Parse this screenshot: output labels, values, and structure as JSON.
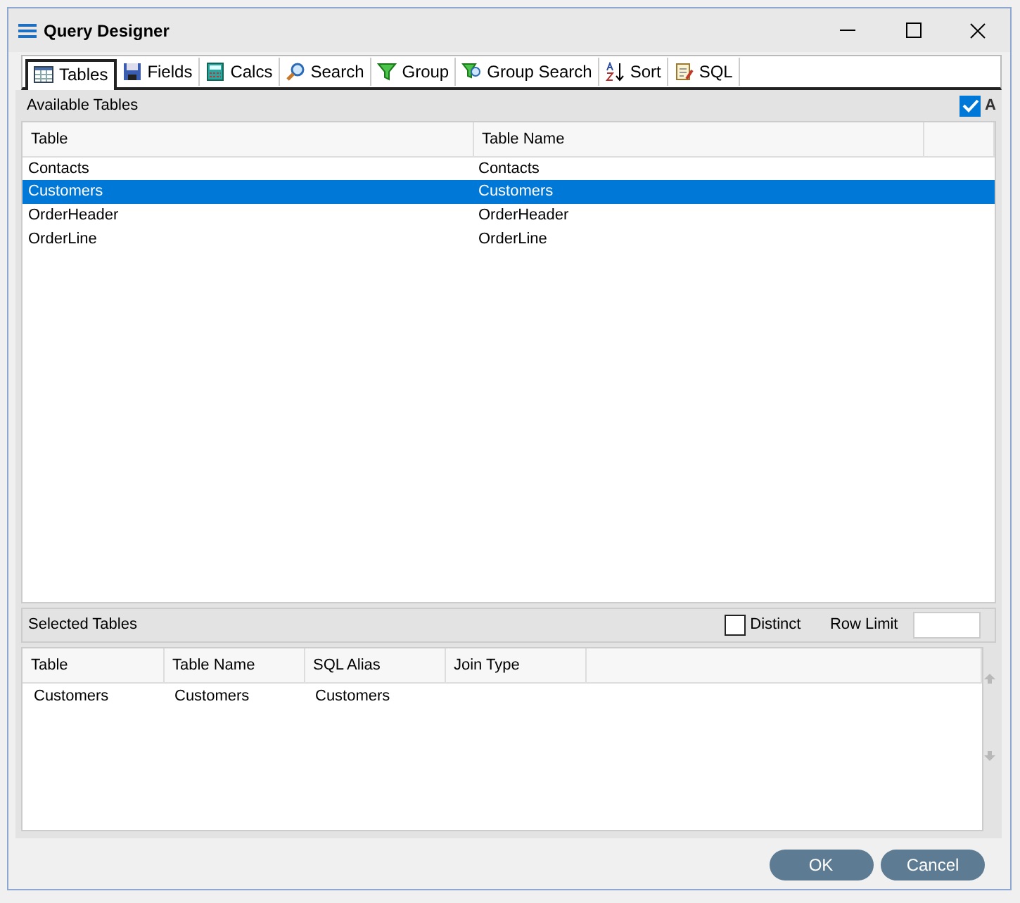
{
  "window": {
    "title": "Query Designer"
  },
  "tabs": [
    {
      "label": "Tables",
      "selected": true
    },
    {
      "label": "Fields",
      "selected": false
    },
    {
      "label": "Calcs",
      "selected": false
    },
    {
      "label": "Search",
      "selected": false
    },
    {
      "label": "Group",
      "selected": false
    },
    {
      "label": "Group Search",
      "selected": false
    },
    {
      "label": "Sort",
      "selected": false
    },
    {
      "label": "SQL",
      "selected": false
    }
  ],
  "available_tables": {
    "title": "Available Tables",
    "all_checkbox": {
      "label": "A",
      "checked": true
    },
    "columns": [
      "Table",
      "Table Name"
    ],
    "rows": [
      {
        "cells": [
          "Contacts",
          "Contacts"
        ],
        "selected": false
      },
      {
        "cells": [
          "Customers",
          "Customers"
        ],
        "selected": true
      },
      {
        "cells": [
          "OrderHeader",
          "OrderHeader"
        ],
        "selected": false
      },
      {
        "cells": [
          "OrderLine",
          "OrderLine"
        ],
        "selected": false
      }
    ]
  },
  "selected_tables": {
    "title": "Selected Tables",
    "distinct": {
      "label": "Distinct",
      "checked": false
    },
    "row_limit": {
      "label": "Row Limit"
    },
    "columns": [
      "Table",
      "Table Name",
      "SQL Alias",
      "Join Type"
    ],
    "rows": [
      {
        "cells": [
          "Customers",
          "Customers",
          "Customers",
          ""
        ]
      }
    ]
  },
  "buttons": [
    "OK",
    "Cancel"
  ]
}
